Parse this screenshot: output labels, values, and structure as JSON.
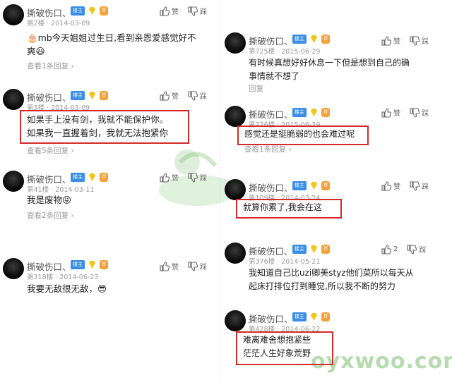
{
  "user": {
    "name": "撕破伤口、",
    "badge_louzhu": "楼主"
  },
  "left": [
    {
      "floor": "第2楼 · 2014-03-09",
      "content": [
        "🎂mb今天姐姐过生日,看到亲恩爱感觉好不",
        "爽😃"
      ],
      "replies": "查看1条回复 ›",
      "zodiac": "♉"
    },
    {
      "floor": "第3楼 · 2014-03-09",
      "content": [
        "如果手上没有剑，我就不能保护你。",
        "如果我一直握着剑，我就无法抱紧你"
      ],
      "replies": "查看5条回复 ›",
      "zodiac": "♉"
    },
    {
      "floor": "第41楼 · 2014-03-11",
      "content": [
        "我是废物😝"
      ],
      "replies": "查看2条回复 ›",
      "zodiac": "♉"
    },
    {
      "floor": "第318楼 · 2014-06-23",
      "content": [
        "我要无敌很无敌，😎"
      ],
      "replies": "",
      "zodiac": "♉"
    }
  ],
  "right": [
    {
      "floor": "第725楼 · 2015-06-29",
      "content": [
        "有时候真想好好休息一下但是想到自己的确",
        "事情就不想了"
      ],
      "replies": "回复",
      "zodiac": "♉"
    },
    {
      "floor": "第726楼 · 2015-06-29",
      "content": [
        "感觉还是挺脆弱的也会难过呢"
      ],
      "replies": "查看1条回复 ›",
      "zodiac": "♉"
    },
    {
      "floor": "第109楼 · 2014-03-24",
      "content": [
        "就算你累了,我会在这"
      ],
      "replies": "",
      "zodiac": "♉"
    },
    {
      "floor": "第376楼 · 2014-05-21",
      "content": [
        "我知道自己比uzi卿美styz他们菜所以每天从",
        "起床打排位打到睡觉,所以我不断的努力"
      ],
      "replies": "",
      "zodiac": "♉",
      "likes": "2"
    },
    {
      "floor": "第428楼 · 2014-06-22",
      "content": [
        "难离难舍想抱紧些",
        "茫茫人生好象荒野"
      ],
      "replies": "",
      "zodiac": "♉"
    }
  ],
  "actions": {
    "like": "赞",
    "dislike": "踩"
  },
  "watermark": {
    "text": "oyxwoo.com"
  },
  "colors": {
    "highlight": "#d42a2a",
    "badge_blue": "#3a8ee6",
    "diamond": "#f5c518",
    "zodiac": "#f3a23a"
  }
}
